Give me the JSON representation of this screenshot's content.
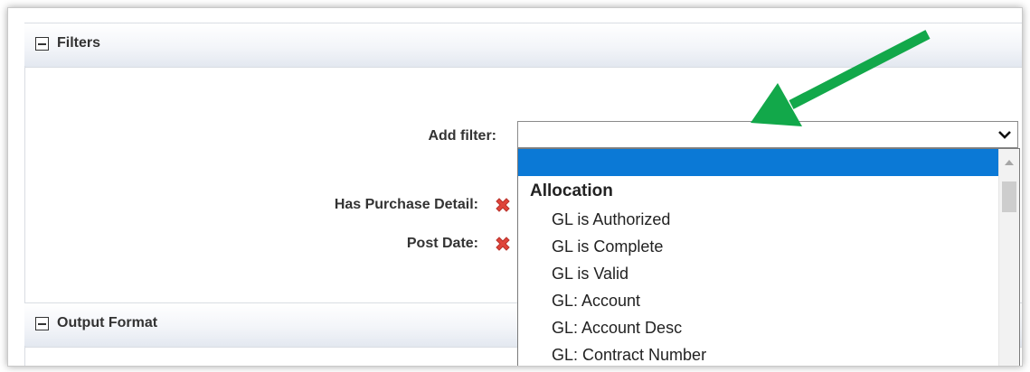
{
  "filters_section": {
    "title": "Filters"
  },
  "add_filter": {
    "label": "Add filter:",
    "selected_value": ""
  },
  "active_filters": [
    {
      "label": "Has Purchase Detail:"
    },
    {
      "label": "Post Date:"
    }
  ],
  "dropdown": {
    "group": "Allocation",
    "items": [
      "GL is Authorized",
      "GL is Complete",
      "GL is Valid",
      "GL: Account",
      "GL: Account Desc",
      "GL: Contract Number"
    ]
  },
  "output_section": {
    "title": "Output Format"
  },
  "colors": {
    "highlight": "#0b79d6",
    "arrow": "#12a84a",
    "remove_icon": "#e0443a"
  }
}
